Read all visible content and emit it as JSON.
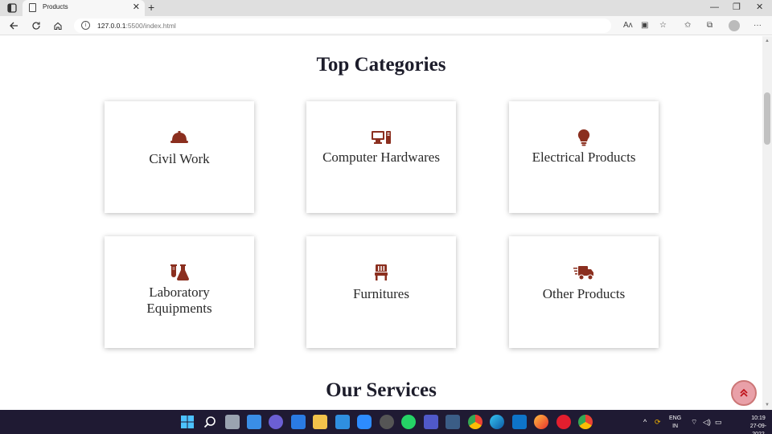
{
  "browser": {
    "tab_title": "Products",
    "url_host": "127.0.0.1",
    "url_rest": ":5500/index.html"
  },
  "page": {
    "top_categories_title": "Top Categories",
    "our_services_title": "Our Services",
    "categories": [
      {
        "label": "Civil Work",
        "icon": "helmet-icon"
      },
      {
        "label": "Computer Hardwares",
        "icon": "computer-icon"
      },
      {
        "label": "Electrical Products",
        "icon": "lightbulb-icon"
      },
      {
        "label": "Laboratory Equipments",
        "icon": "lab-flask-icon"
      },
      {
        "label": "Furnitures",
        "icon": "chair-icon"
      },
      {
        "label": "Other Products",
        "icon": "delivery-truck-icon"
      }
    ],
    "accent_color": "#8b2f1f"
  },
  "taskbar": {
    "lang_line1": "ENG",
    "lang_line2": "IN",
    "time": "10:19",
    "date": "27-09-2022"
  }
}
